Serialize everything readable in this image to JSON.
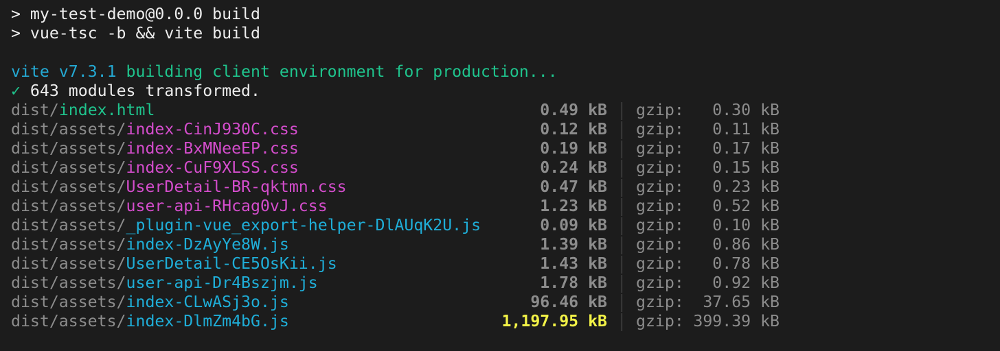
{
  "command": {
    "line1": "> my-test-demo@0.0.0 build",
    "line2": "> vue-tsc -b && vite build"
  },
  "build": {
    "vite_version": "vite v7.3.1",
    "status_message": " building client environment for production...",
    "check_mark": "✓",
    "modules_message": " 643 modules transformed."
  },
  "gzip_label": "gzip:",
  "files": [
    {
      "dir": "dist/",
      "name": "index.html",
      "type": "html",
      "size": "0.49 kB",
      "gzip": "0.30 kB"
    },
    {
      "dir": "dist/assets/",
      "name": "index-CinJ930C.css",
      "type": "css",
      "size": "0.12 kB",
      "gzip": "0.11 kB"
    },
    {
      "dir": "dist/assets/",
      "name": "index-BxMNeeEP.css",
      "type": "css",
      "size": "0.19 kB",
      "gzip": "0.17 kB"
    },
    {
      "dir": "dist/assets/",
      "name": "index-CuF9XLSS.css",
      "type": "css",
      "size": "0.24 kB",
      "gzip": "0.15 kB"
    },
    {
      "dir": "dist/assets/",
      "name": "UserDetail-BR-qktmn.css",
      "type": "css",
      "size": "0.47 kB",
      "gzip": "0.23 kB"
    },
    {
      "dir": "dist/assets/",
      "name": "user-api-RHcag0vJ.css",
      "type": "css",
      "size": "1.23 kB",
      "gzip": "0.52 kB"
    },
    {
      "dir": "dist/assets/",
      "name": "_plugin-vue_export-helper-DlAUqK2U.js",
      "type": "js",
      "size": "0.09 kB",
      "gzip": "0.10 kB"
    },
    {
      "dir": "dist/assets/",
      "name": "index-DzAyYe8W.js",
      "type": "js",
      "size": "1.39 kB",
      "gzip": "0.86 kB"
    },
    {
      "dir": "dist/assets/",
      "name": "UserDetail-CE5OsKii.js",
      "type": "js",
      "size": "1.43 kB",
      "gzip": "0.78 kB"
    },
    {
      "dir": "dist/assets/",
      "name": "user-api-Dr4Bszjm.js",
      "type": "js",
      "size": "1.78 kB",
      "gzip": "0.92 kB"
    },
    {
      "dir": "dist/assets/",
      "name": "index-CLwASj3o.js",
      "type": "js",
      "size": "96.46 kB",
      "gzip": "37.65 kB"
    },
    {
      "dir": "dist/assets/",
      "name": "index-DlmZm4bG.js",
      "type": "js",
      "size": "1,197.95 kB",
      "gzip": "399.39 kB",
      "large": true
    }
  ],
  "colors": {
    "background": "#1c1c1c",
    "text": "#ededed",
    "dim": "#8c8c8c",
    "vite_cyan": "#24a9d3",
    "success_green": "#1fc48d",
    "css_magenta": "#d44dcc",
    "js_cyan": "#1faed8",
    "warning_yellow": "#f2f247"
  }
}
